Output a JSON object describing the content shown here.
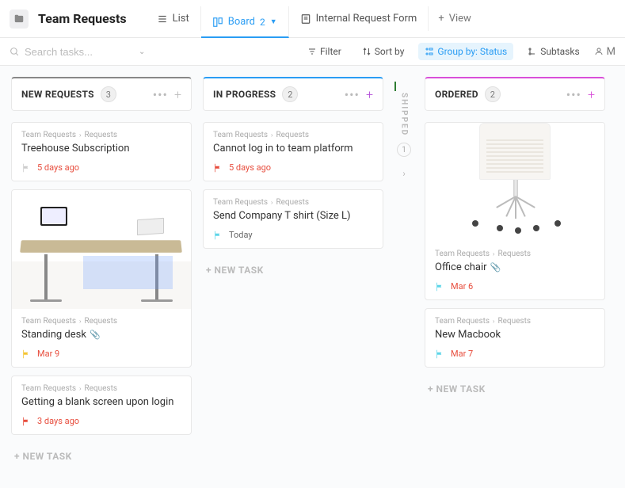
{
  "header": {
    "title": "Team Requests",
    "tabs": [
      {
        "label": "List"
      },
      {
        "label": "Board",
        "count": "2"
      },
      {
        "label": "Internal Request Form"
      }
    ],
    "add_view": "View"
  },
  "toolbar": {
    "search_placeholder": "Search tasks...",
    "filter": "Filter",
    "sort": "Sort by",
    "group": "Group by: Status",
    "subtasks": "Subtasks",
    "user_prefix": "M"
  },
  "columns": {
    "new_requests": {
      "title": "NEW REQUESTS",
      "count": "3",
      "cards": [
        {
          "breadcrumb1": "Team Requests",
          "breadcrumb2": "Requests",
          "title": "Treehouse Subscription",
          "date": "5 days ago",
          "flag": "gray",
          "date_class": "red"
        },
        {
          "breadcrumb1": "Team Requests",
          "breadcrumb2": "Requests",
          "title": "Standing desk",
          "date": "Mar 9",
          "flag": "yellow",
          "date_class": "red",
          "has_image": true,
          "has_attach": true
        },
        {
          "breadcrumb1": "Team Requests",
          "breadcrumb2": "Requests",
          "title": "Getting a blank screen upon login",
          "date": "3 days ago",
          "flag": "red",
          "date_class": "red"
        }
      ]
    },
    "in_progress": {
      "title": "IN PROGRESS",
      "count": "2",
      "cards": [
        {
          "breadcrumb1": "Team Requests",
          "breadcrumb2": "Requests",
          "title": "Cannot log in to team platform",
          "date": "5 days ago",
          "flag": "red",
          "date_class": "red"
        },
        {
          "breadcrumb1": "Team Requests",
          "breadcrumb2": "Requests",
          "title": "Send Company T shirt (Size L)",
          "date": "Today",
          "flag": "cyan",
          "date_class": "today"
        }
      ]
    },
    "shipped": {
      "title": "SHIPPED",
      "count": "1"
    },
    "ordered": {
      "title": "ORDERED",
      "count": "2",
      "cards": [
        {
          "breadcrumb1": "Team Requests",
          "breadcrumb2": "Requests",
          "title": "Office chair",
          "date": "Mar 6",
          "flag": "cyan",
          "date_class": "red",
          "has_image": true,
          "has_attach": true
        },
        {
          "breadcrumb1": "Team Requests",
          "breadcrumb2": "Requests",
          "title": "New Macbook",
          "date": "Mar 7",
          "flag": "cyan",
          "date_class": "red"
        }
      ]
    }
  },
  "new_task_label": "+ NEW TASK"
}
